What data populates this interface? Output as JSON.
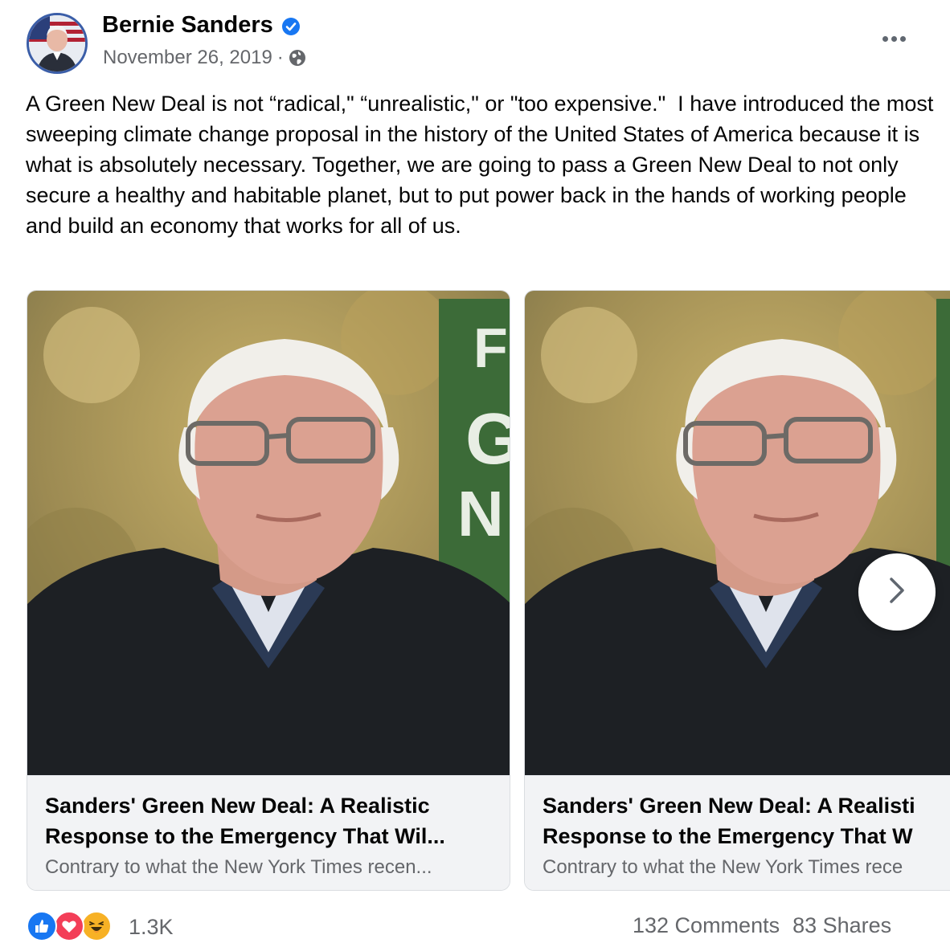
{
  "post": {
    "author": "Bernie Sanders",
    "verified_icon": "verified-badge-icon",
    "date": "November 26, 2019",
    "separator": "·",
    "audience_icon": "globe-icon",
    "more_icon": "more-options-icon",
    "text": "A Green New Deal is not “radical,\" “unrealistic,\" or \"too expensive.\"  I have introduced the most sweeping climate change proposal in the history of the United States of America because it is what is absolutely necessary. Together, we are going to pass a Green New Deal to not only secure a healthy and habitable planet, but to put power back in the hands of working people and build an economy that works for all of us."
  },
  "cards": [
    {
      "title_line1": "Sanders' Green New Deal: A Realistic",
      "title_line2": "Response to the Emergency That Wil...",
      "description": "Contrary to what the New York Times recen...",
      "sign_text": "F G N"
    },
    {
      "title_line1": "Sanders' Green New Deal: A Realisti",
      "title_line2": "Response to the Emergency That W",
      "description": "Contrary to what the New York Times rece"
    }
  ],
  "carousel": {
    "next_icon": "chevron-right-icon"
  },
  "footer": {
    "reaction_icons": [
      "like-icon",
      "love-icon",
      "haha-icon"
    ],
    "reaction_count": "1.3K",
    "comments": "132 Comments",
    "shares": "83 Shares"
  },
  "colors": {
    "verified": "#1877f2",
    "secondary_text": "#65676b",
    "caption_bg": "#f2f3f5",
    "like": "#1877f2",
    "love": "#f33e58",
    "haha": "#f7b125"
  }
}
